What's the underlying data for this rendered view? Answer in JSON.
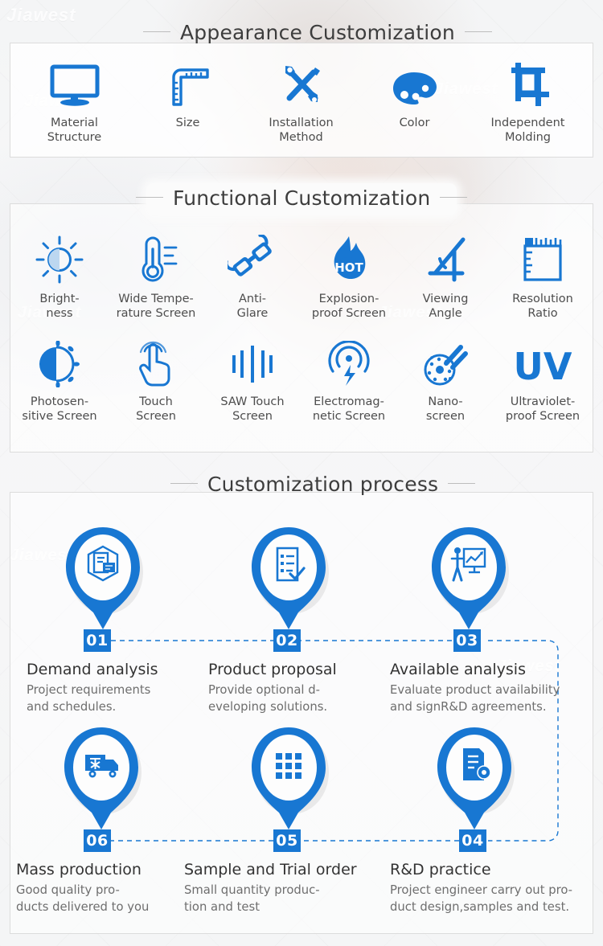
{
  "watermark": "Jiawest",
  "colors": {
    "blue": "#1877d2",
    "blue_dark": "#1565b8",
    "text": "#3d3d3d",
    "muted": "#6e6e6e",
    "card_border": "#dcdcdc"
  },
  "sections": [
    {
      "id": "appearance",
      "title": "Appearance Customization",
      "items": [
        {
          "icon": "monitor-icon",
          "label": "Material\nStructure"
        },
        {
          "icon": "ruler-icon",
          "label": "Size"
        },
        {
          "icon": "tools-icon",
          "label": "Installation\nMethod"
        },
        {
          "icon": "palette-icon",
          "label": "Color"
        },
        {
          "icon": "crop-icon",
          "label": "Independent\nMolding"
        }
      ]
    },
    {
      "id": "functional",
      "title": "Functional Customization",
      "items": [
        {
          "icon": "brightness-sun-icon",
          "label": "Bright-\nness"
        },
        {
          "icon": "thermometer-icon",
          "label": "Wide Tempe-\nrature Screen"
        },
        {
          "icon": "glasses-icon",
          "label": "Anti-\nGlare"
        },
        {
          "icon": "flame-hot-icon",
          "label": "Explosion-\nproof Screen"
        },
        {
          "icon": "viewing-angle-icon",
          "label": "Viewing\nAngle"
        },
        {
          "icon": "resolution-ruler-icon",
          "label": "Resolution\nRatio"
        },
        {
          "icon": "photosensitive-icon",
          "label": "Photosen-\nsitive Screen"
        },
        {
          "icon": "touch-hand-icon",
          "label": "Touch\nScreen"
        },
        {
          "icon": "saw-wave-icon",
          "label": "SAW Touch\nScreen"
        },
        {
          "icon": "electromagnetic-icon",
          "label": "Electromag-\nnetic Screen"
        },
        {
          "icon": "nano-icon",
          "label": "Nano-\nscreen"
        },
        {
          "icon": "uv-text-icon",
          "label": "Ultraviolet-\nproof Screen"
        }
      ]
    }
  ],
  "process": {
    "title": "Customization process",
    "steps": [
      {
        "number": "01",
        "icon": "contract-hex-icon",
        "title": "Demand analysis",
        "desc": "Project requirements\nand schedules."
      },
      {
        "number": "02",
        "icon": "checklist-icon",
        "title": "Product proposal",
        "desc": "Provide optional d-\neveloping solutions."
      },
      {
        "number": "03",
        "icon": "presentation-icon",
        "title": "Available analysis",
        "desc": "Evaluate product availability\nand signR&D agreements."
      },
      {
        "number": "04",
        "icon": "document-gear-icon",
        "title": "R&D practice",
        "desc": "Project engineer carry out pro-\nduct design,samples and test."
      },
      {
        "number": "05",
        "icon": "grid-dots-icon",
        "title": "Sample and Trial order",
        "desc": "Small quantity produc-\ntion and test"
      },
      {
        "number": "06",
        "icon": "delivery-truck-icon",
        "title": "Mass production",
        "desc": "Good quality pro-\nducts delivered to you"
      }
    ]
  }
}
